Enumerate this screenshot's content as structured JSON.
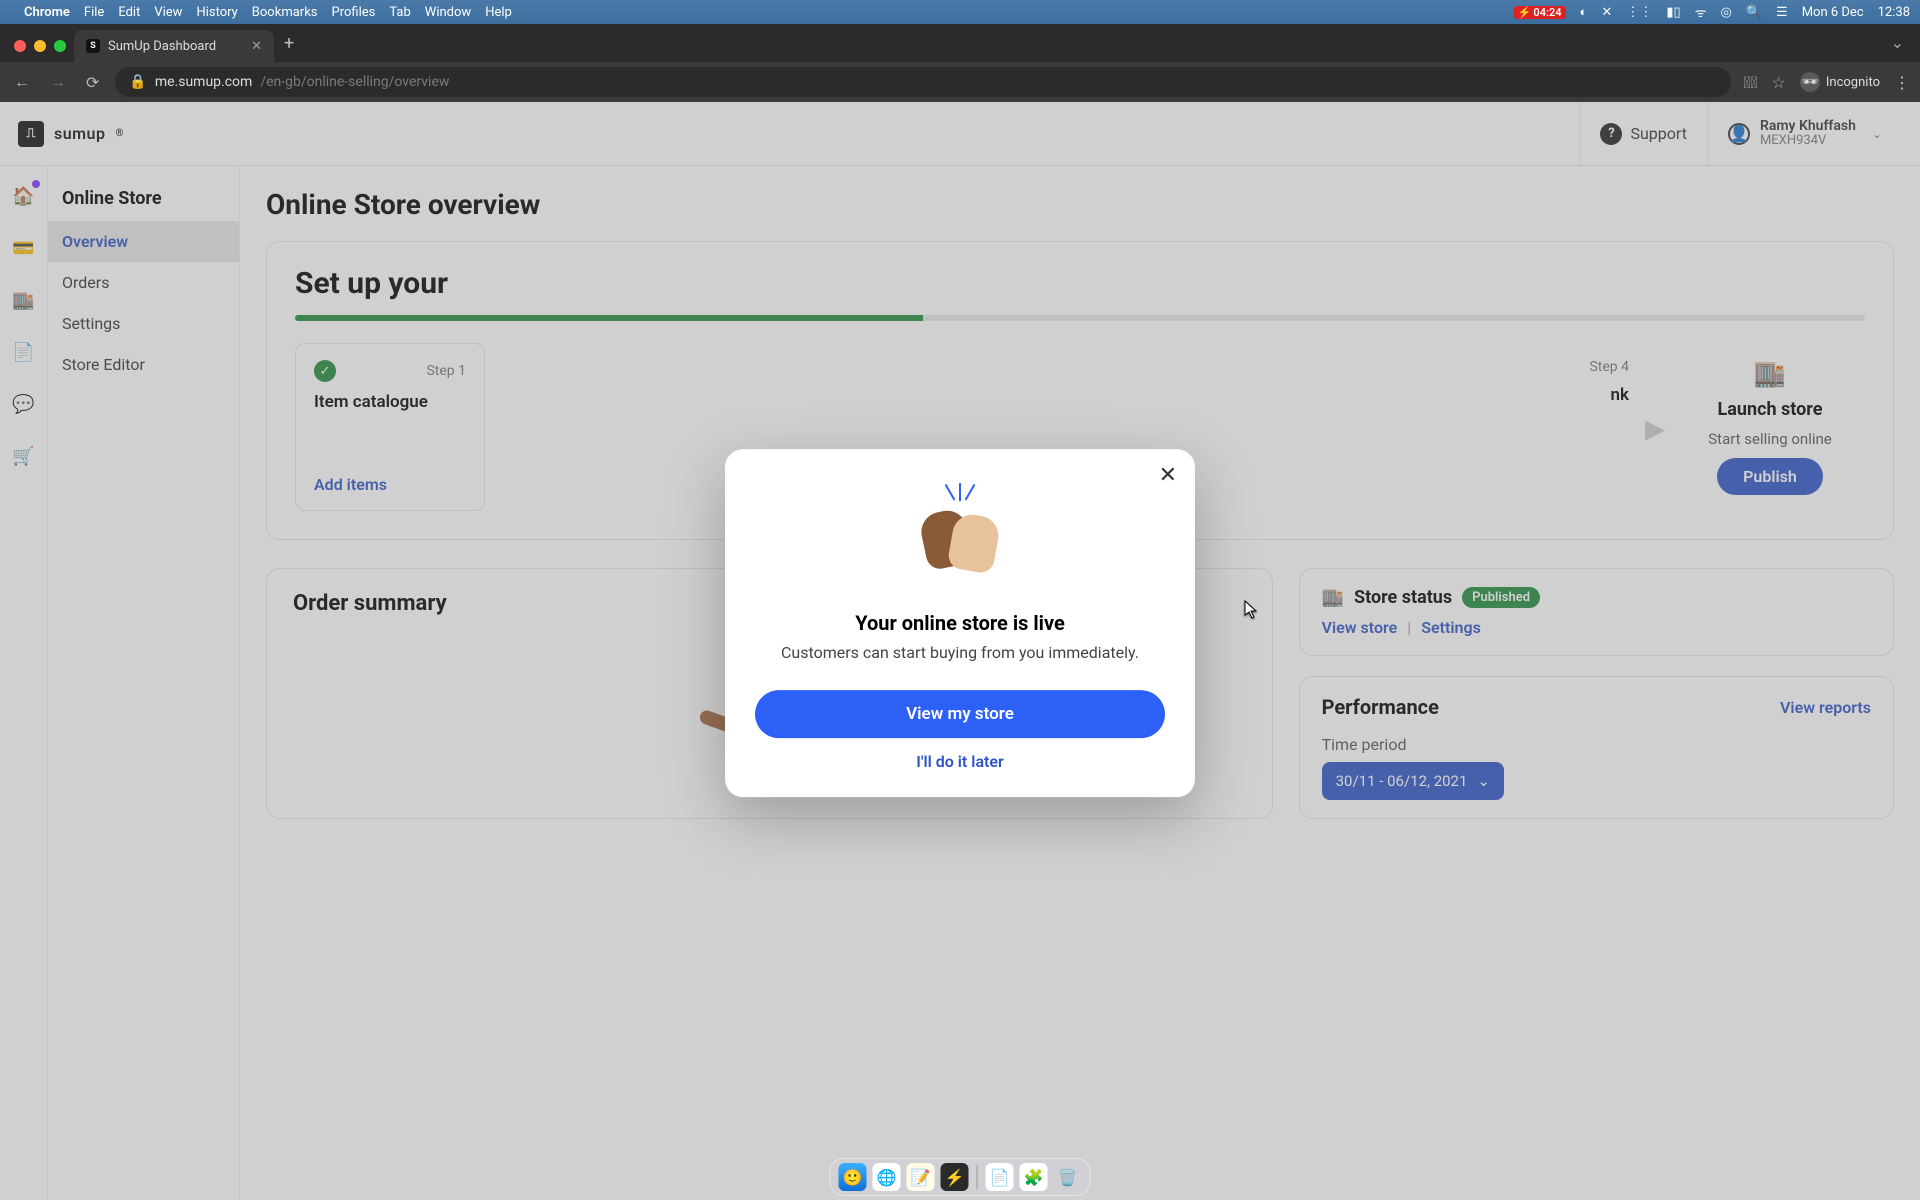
{
  "menubar": {
    "app": "Chrome",
    "items": [
      "File",
      "Edit",
      "View",
      "History",
      "Bookmarks",
      "Profiles",
      "Tab",
      "Window",
      "Help"
    ],
    "battery": "04:24",
    "date": "Mon 6 Dec",
    "time": "12:38"
  },
  "tab": {
    "title": "SumUp Dashboard"
  },
  "address": {
    "host": "me.sumup.com",
    "path": "/en-gb/online-selling/overview",
    "incognito": "Incognito"
  },
  "topbar": {
    "brand": "sumup",
    "support": "Support",
    "user_name": "Ramy Khuffash",
    "user_code": "MEXH934V"
  },
  "sidebar": {
    "title": "Online Store",
    "items": [
      "Overview",
      "Orders",
      "Settings",
      "Store Editor"
    ]
  },
  "page": {
    "title": "Online Store overview"
  },
  "setup": {
    "heading": "Set up your",
    "step1_label": "Step 1",
    "step1_title": "Item catalogue",
    "step1_link": "Add items",
    "step4_label": "Step 4",
    "step4_partial": "nk",
    "launch_title": "Launch store",
    "launch_sub": "Start selling online",
    "publish": "Publish"
  },
  "order_summary": {
    "title": "Order summary"
  },
  "status": {
    "label": "Store status",
    "badge": "Published",
    "view": "View store",
    "settings": "Settings"
  },
  "perf": {
    "title": "Performance",
    "reports": "View reports",
    "period_label": "Time period",
    "range": "30/11 - 06/12, 2021"
  },
  "modal": {
    "title": "Your online store is live",
    "body": "Customers can start buying from you immediately.",
    "primary": "View my store",
    "secondary": "I'll do it later"
  }
}
